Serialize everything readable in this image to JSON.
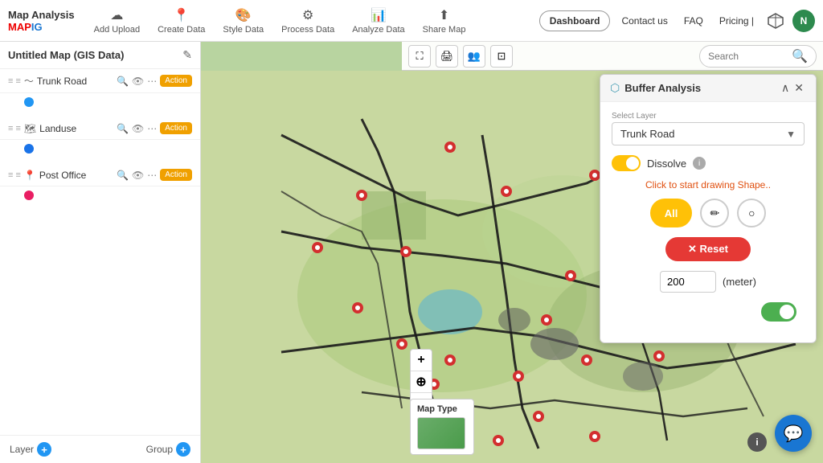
{
  "app": {
    "title": "Map Analysis",
    "logo_sub": "MAP",
    "logo_accent": "IG"
  },
  "nav": {
    "items": [
      {
        "id": "add-upload",
        "icon": "☁",
        "label": "Add Upload"
      },
      {
        "id": "create-data",
        "icon": "📍",
        "label": "Create Data"
      },
      {
        "id": "style-data",
        "icon": "🎨",
        "label": "Style Data"
      },
      {
        "id": "process-data",
        "icon": "⚙",
        "label": "Process Data"
      },
      {
        "id": "analyze-data",
        "icon": "📊",
        "label": "Analyze Data"
      },
      {
        "id": "share-map",
        "icon": "⬆",
        "label": "Share Map"
      }
    ]
  },
  "topbar_right": {
    "dashboard": "Dashboard",
    "contact": "Contact us",
    "faq": "FAQ",
    "pricing": "Pricing |",
    "user_initials": "N"
  },
  "left_panel": {
    "title": "Untitled Map (GIS Data)",
    "layers": [
      {
        "name": "Trunk Road",
        "icon": "〜",
        "dot_color": "#2196f3",
        "has_action": true
      },
      {
        "name": "Landuse",
        "icon": "🗺",
        "dot_color": "#1a73e8",
        "has_action": true
      },
      {
        "name": "Post Office",
        "icon": "📍",
        "dot_color": "#e91e63",
        "has_action": true
      }
    ],
    "layer_btn": "Layer",
    "group_btn": "Group"
  },
  "map_toolbar": {
    "search_placeholder": "Search",
    "tools": [
      "⛶",
      "🖨",
      "👥",
      "⊡"
    ]
  },
  "map_type": {
    "label": "Map Type"
  },
  "buffer_panel": {
    "title": "Buffer Analysis",
    "select_layer_label": "Select Layer",
    "selected_layer": "Trunk Road",
    "dissolve_label": "Dissolve",
    "draw_shape_text": "Click to start drawing Shape..",
    "buttons": {
      "all": "All",
      "pencil": "✏",
      "circle": "○"
    },
    "reset_label": "Reset",
    "meter_value": "200",
    "meter_unit": "(meter)"
  },
  "chat_bubble": {
    "icon": "💬"
  },
  "info_btn": {
    "label": "i"
  },
  "zoom": {
    "plus": "+",
    "compass": "⊕",
    "minus": "−"
  }
}
